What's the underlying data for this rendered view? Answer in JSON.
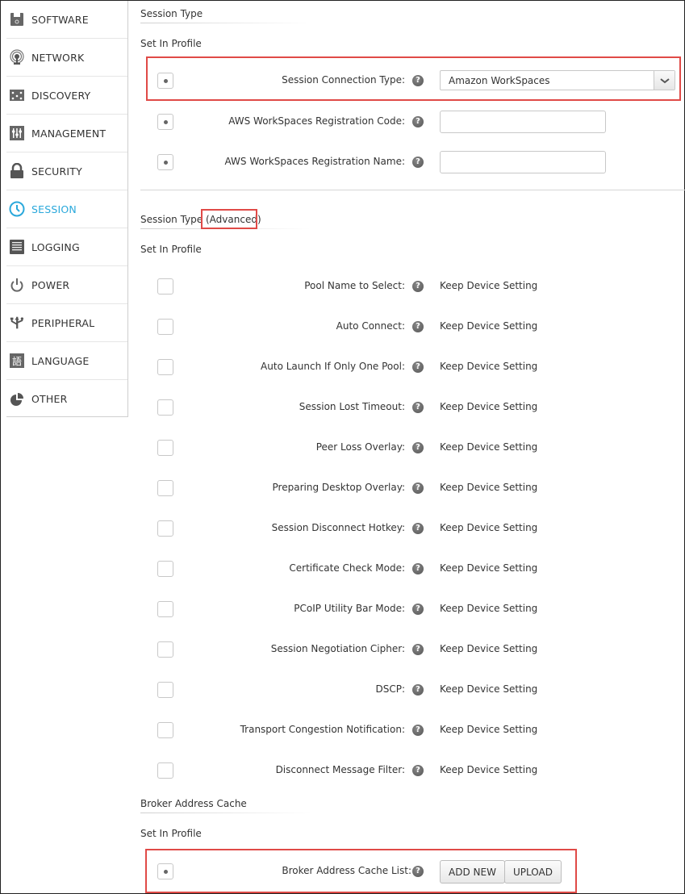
{
  "sidebar": {
    "items": [
      {
        "label": "SOFTWARE",
        "icon": "floppy-disk-icon",
        "active": false
      },
      {
        "label": "NETWORK",
        "icon": "antenna-icon",
        "active": false
      },
      {
        "label": "DISCOVERY",
        "icon": "discovery-nodes-icon",
        "active": false
      },
      {
        "label": "MANAGEMENT",
        "icon": "sliders-icon",
        "active": false
      },
      {
        "label": "SECURITY",
        "icon": "lock-icon",
        "active": false
      },
      {
        "label": "SESSION",
        "icon": "clock-icon",
        "active": true
      },
      {
        "label": "LOGGING",
        "icon": "log-list-icon",
        "active": false
      },
      {
        "label": "POWER",
        "icon": "power-icon",
        "active": false
      },
      {
        "label": "PERIPHERAL",
        "icon": "usb-icon",
        "active": false
      },
      {
        "label": "LANGUAGE",
        "icon": "language-char-icon",
        "active": false
      },
      {
        "label": "OTHER",
        "icon": "pie-chart-icon",
        "active": false
      }
    ],
    "active_color": "#2aa8db"
  },
  "session_type": {
    "title": "Session Type",
    "set_in_profile": "Set In Profile",
    "connection_type": {
      "label": "Session Connection Type:",
      "value": "Amazon WorkSpaces",
      "checked": true
    },
    "reg_code": {
      "label": "AWS WorkSpaces Registration Code:",
      "value": "",
      "checked": true
    },
    "reg_name": {
      "label": "AWS WorkSpaces Registration Name:",
      "value": "",
      "checked": true
    }
  },
  "session_type_advanced": {
    "title_main": "Session Type",
    "title_suffix": "(Advanced)",
    "set_in_profile": "Set In Profile",
    "rows": [
      {
        "label": "Pool Name to Select:",
        "value": "Keep Device Setting"
      },
      {
        "label": "Auto Connect:",
        "value": "Keep Device Setting"
      },
      {
        "label": "Auto Launch If Only One Pool:",
        "value": "Keep Device Setting"
      },
      {
        "label": "Session Lost Timeout:",
        "value": "Keep Device Setting"
      },
      {
        "label": "Peer Loss Overlay:",
        "value": "Keep Device Setting"
      },
      {
        "label": "Preparing Desktop Overlay:",
        "value": "Keep Device Setting"
      },
      {
        "label": "Session Disconnect Hotkey:",
        "value": "Keep Device Setting"
      },
      {
        "label": "Certificate Check Mode:",
        "value": "Keep Device Setting"
      },
      {
        "label": "PCoIP Utility Bar Mode:",
        "value": "Keep Device Setting"
      },
      {
        "label": "Session Negotiation Cipher:",
        "value": "Keep Device Setting"
      },
      {
        "label": "DSCP:",
        "value": "Keep Device Setting"
      },
      {
        "label": "Transport Congestion Notification:",
        "value": "Keep Device Setting"
      },
      {
        "label": "Disconnect Message Filter:",
        "value": "Keep Device Setting"
      }
    ]
  },
  "broker_cache": {
    "title": "Broker Address Cache",
    "set_in_profile": "Set In Profile",
    "row": {
      "label": "Broker Address Cache List:",
      "checked": true
    },
    "add_new_label": "ADD NEW",
    "upload_label": "UPLOAD"
  },
  "help_glyph": "?",
  "highlight_color": "#e04a47"
}
